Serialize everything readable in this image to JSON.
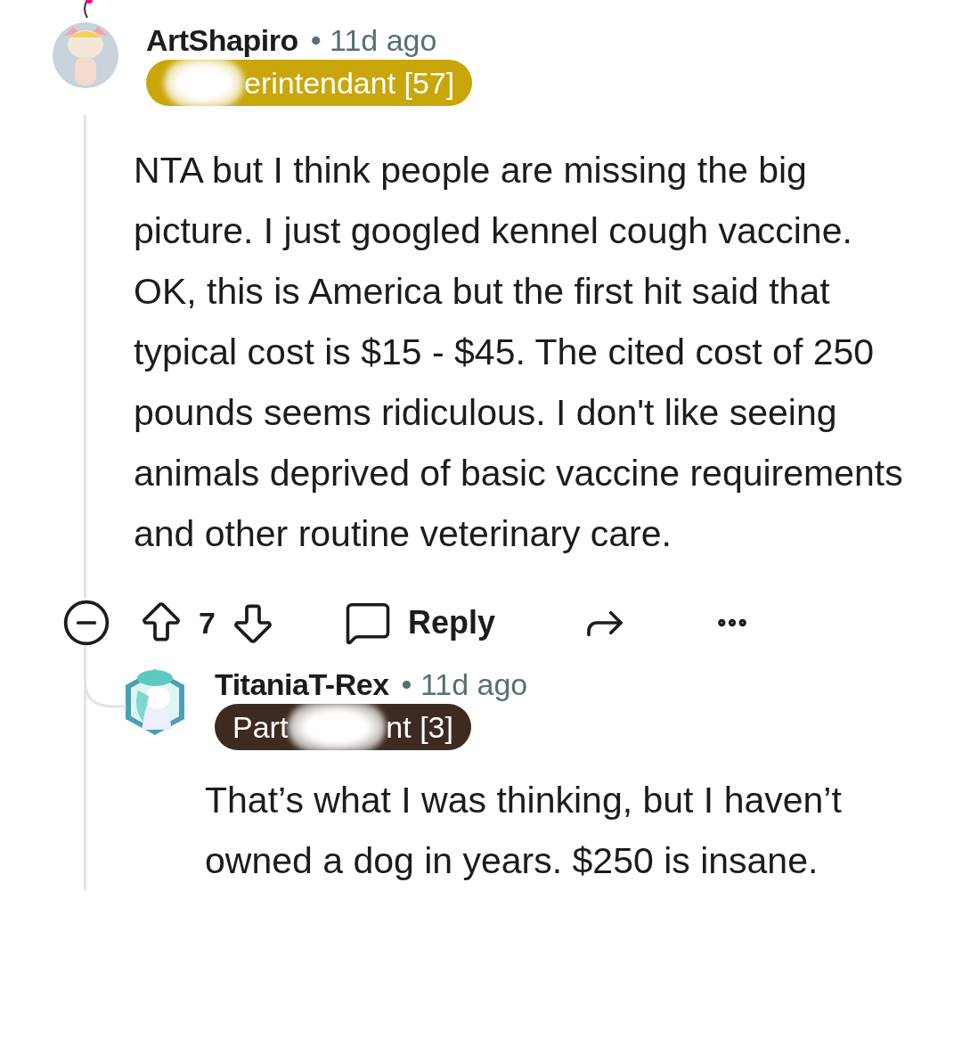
{
  "comment": {
    "author": "ArtShapiro",
    "time": "• 11d ago",
    "flair": {
      "color": "#c9a60a",
      "segments": [
        {
          "kind": "smudge"
        },
        {
          "kind": "text",
          "text": "erintendant [57]"
        }
      ]
    },
    "body": "NTA but I think people are missing the big picture. I just googled kennel cough vaccine. OK, this is America but the first hit said that typical cost is $15 - $45. The cited cost of 250 pounds seems ridiculous. I don't like seeing animals deprived of basic vaccine requirements and other routine veterinary care.",
    "votes": "7",
    "reply_label": "Reply",
    "reply": {
      "author": "TitaniaT-Rex",
      "time": "• 11d ago",
      "flair": {
        "color": "#3d2a22",
        "segments": [
          {
            "kind": "text",
            "text": "Part"
          },
          {
            "kind": "smudge"
          },
          {
            "kind": "text",
            "text": "nt [3]"
          }
        ]
      },
      "body": "That’s what I was thinking, but I haven’t owned a dog in years. $250 is insane."
    }
  }
}
